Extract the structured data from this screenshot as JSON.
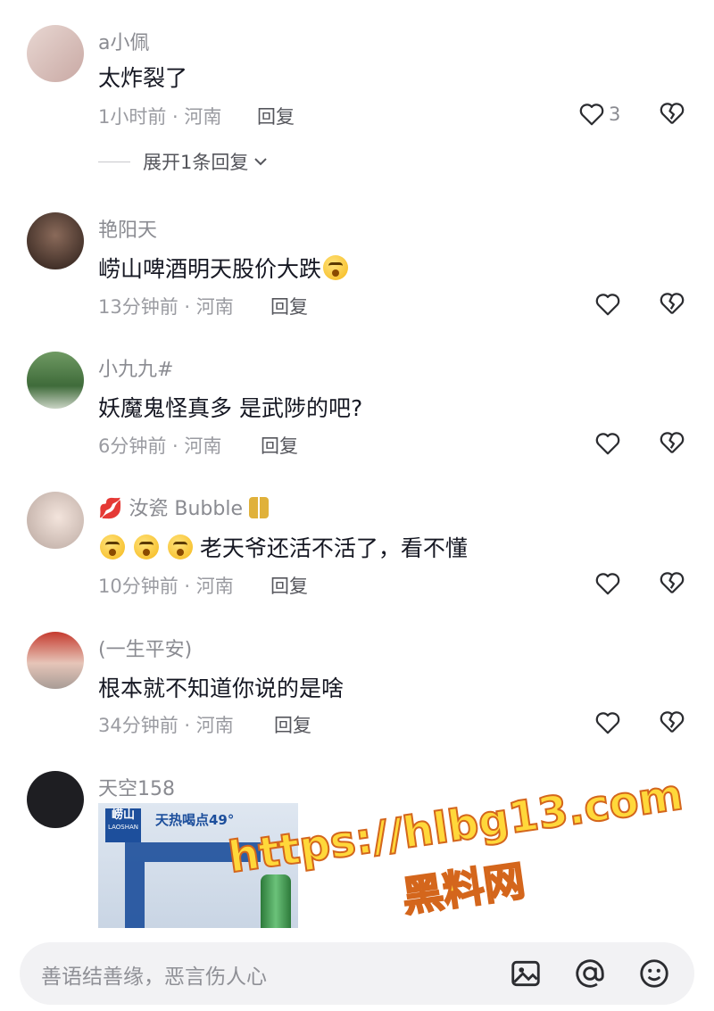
{
  "comments": [
    {
      "username": "a小佩",
      "text": "太炸裂了",
      "time": "1小时前 · 河南",
      "reply": "回复",
      "likes": "3",
      "expand": "展开1条回复",
      "avatar_color": "#d9c3c0"
    },
    {
      "username": "艳阳天",
      "text": "崂山啤酒明天股价大跌",
      "time": "13分钟前 · 河南",
      "reply": "回复",
      "avatar_color": "#3a2a24"
    },
    {
      "username": "小九九#",
      "text": "妖魔鬼怪真多 是武陟的吧?",
      "time": "6分钟前 · 河南",
      "reply": "回复",
      "avatar_color": "#4d7a48"
    },
    {
      "username": "汝瓷 Bubble",
      "text": "老天爷还活不活了，看不懂",
      "time": "10分钟前 · 河南",
      "reply": "回复",
      "avatar_color": "#e9e2de"
    },
    {
      "username": "(一生平安)",
      "text": "根本就不知道你说的是啥",
      "time": "34分钟前 · 河南",
      "reply": "回复",
      "avatar_color": "#c94a3a"
    },
    {
      "username": "天空158",
      "avatar_color": "#1e1e22"
    }
  ],
  "post_image": {
    "brand": "崂山",
    "brand_en": "LAOSHAN",
    "banner": "天热喝点49°"
  },
  "watermark": {
    "line1": "https://hlbg13.com",
    "line2": "黑料网"
  },
  "bottom": {
    "placeholder": "善语结善缘，恶言伤人心"
  },
  "colors": {
    "text": "#161823",
    "secondary": "#8a8b91",
    "icon": "#2b2c30"
  }
}
